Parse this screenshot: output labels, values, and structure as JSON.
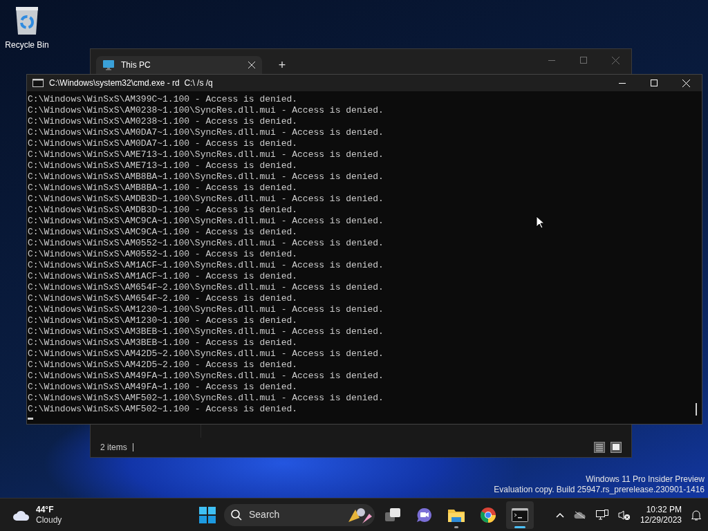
{
  "desktop_icons": [
    {
      "label": "Recycle Bin"
    }
  ],
  "explorer": {
    "tabs": [
      {
        "label": "This PC",
        "selected": true
      }
    ],
    "new_tab": "+",
    "status": "2 items"
  },
  "console": {
    "title": "C:\\Windows\\system32\\cmd.exe - rd  C:\\ /s /q",
    "lines": [
      "C:\\Windows\\WinSxS\\AM399C~1.100 - Access is denied.",
      "C:\\Windows\\WinSxS\\AM0238~1.100\\SyncRes.dll.mui - Access is denied.",
      "C:\\Windows\\WinSxS\\AM0238~1.100 - Access is denied.",
      "C:\\Windows\\WinSxS\\AM0DA7~1.100\\SyncRes.dll.mui - Access is denied.",
      "C:\\Windows\\WinSxS\\AM0DA7~1.100 - Access is denied.",
      "C:\\Windows\\WinSxS\\AME713~1.100\\SyncRes.dll.mui - Access is denied.",
      "C:\\Windows\\WinSxS\\AME713~1.100 - Access is denied.",
      "C:\\Windows\\WinSxS\\AMB8BA~1.100\\SyncRes.dll.mui - Access is denied.",
      "C:\\Windows\\WinSxS\\AMB8BA~1.100 - Access is denied.",
      "C:\\Windows\\WinSxS\\AMDB3D~1.100\\SyncRes.dll.mui - Access is denied.",
      "C:\\Windows\\WinSxS\\AMDB3D~1.100 - Access is denied.",
      "C:\\Windows\\WinSxS\\AMC9CA~1.100\\SyncRes.dll.mui - Access is denied.",
      "C:\\Windows\\WinSxS\\AMC9CA~1.100 - Access is denied.",
      "C:\\Windows\\WinSxS\\AM0552~1.100\\SyncRes.dll.mui - Access is denied.",
      "C:\\Windows\\WinSxS\\AM0552~1.100 - Access is denied.",
      "C:\\Windows\\WinSxS\\AM1ACF~1.100\\SyncRes.dll.mui - Access is denied.",
      "C:\\Windows\\WinSxS\\AM1ACF~1.100 - Access is denied.",
      "C:\\Windows\\WinSxS\\AM654F~2.100\\SyncRes.dll.mui - Access is denied.",
      "C:\\Windows\\WinSxS\\AM654F~2.100 - Access is denied.",
      "C:\\Windows\\WinSxS\\AM1230~1.100\\SyncRes.dll.mui - Access is denied.",
      "C:\\Windows\\WinSxS\\AM1230~1.100 - Access is denied.",
      "C:\\Windows\\WinSxS\\AM3BEB~1.100\\SyncRes.dll.mui - Access is denied.",
      "C:\\Windows\\WinSxS\\AM3BEB~1.100 - Access is denied.",
      "C:\\Windows\\WinSxS\\AM42D5~2.100\\SyncRes.dll.mui - Access is denied.",
      "C:\\Windows\\WinSxS\\AM42D5~2.100 - Access is denied.",
      "C:\\Windows\\WinSxS\\AM49FA~1.100\\SyncRes.dll.mui - Access is denied.",
      "C:\\Windows\\WinSxS\\AM49FA~1.100 - Access is denied.",
      "C:\\Windows\\WinSxS\\AMF502~1.100\\SyncRes.dll.mui - Access is denied.",
      "C:\\Windows\\WinSxS\\AMF502~1.100 - Access is denied."
    ]
  },
  "watermark": [
    "Windows 11 Pro Insider Preview",
    "Evaluation copy. Build 25947.rs_prerelease.230901-1416"
  ],
  "taskbar": {
    "weather": {
      "temp": "44°F",
      "condition": "Cloudy"
    },
    "search": {
      "placeholder": "Search"
    },
    "apps": [
      {
        "kind": "taskview",
        "running": false,
        "selected": false
      },
      {
        "kind": "meet",
        "running": false,
        "selected": false
      },
      {
        "kind": "explorer",
        "running": true,
        "selected": false
      },
      {
        "kind": "chrome",
        "running": false,
        "selected": false
      },
      {
        "kind": "terminal",
        "running": true,
        "selected": true
      }
    ],
    "time": "10:32 PM",
    "date": "12/29/2023"
  }
}
